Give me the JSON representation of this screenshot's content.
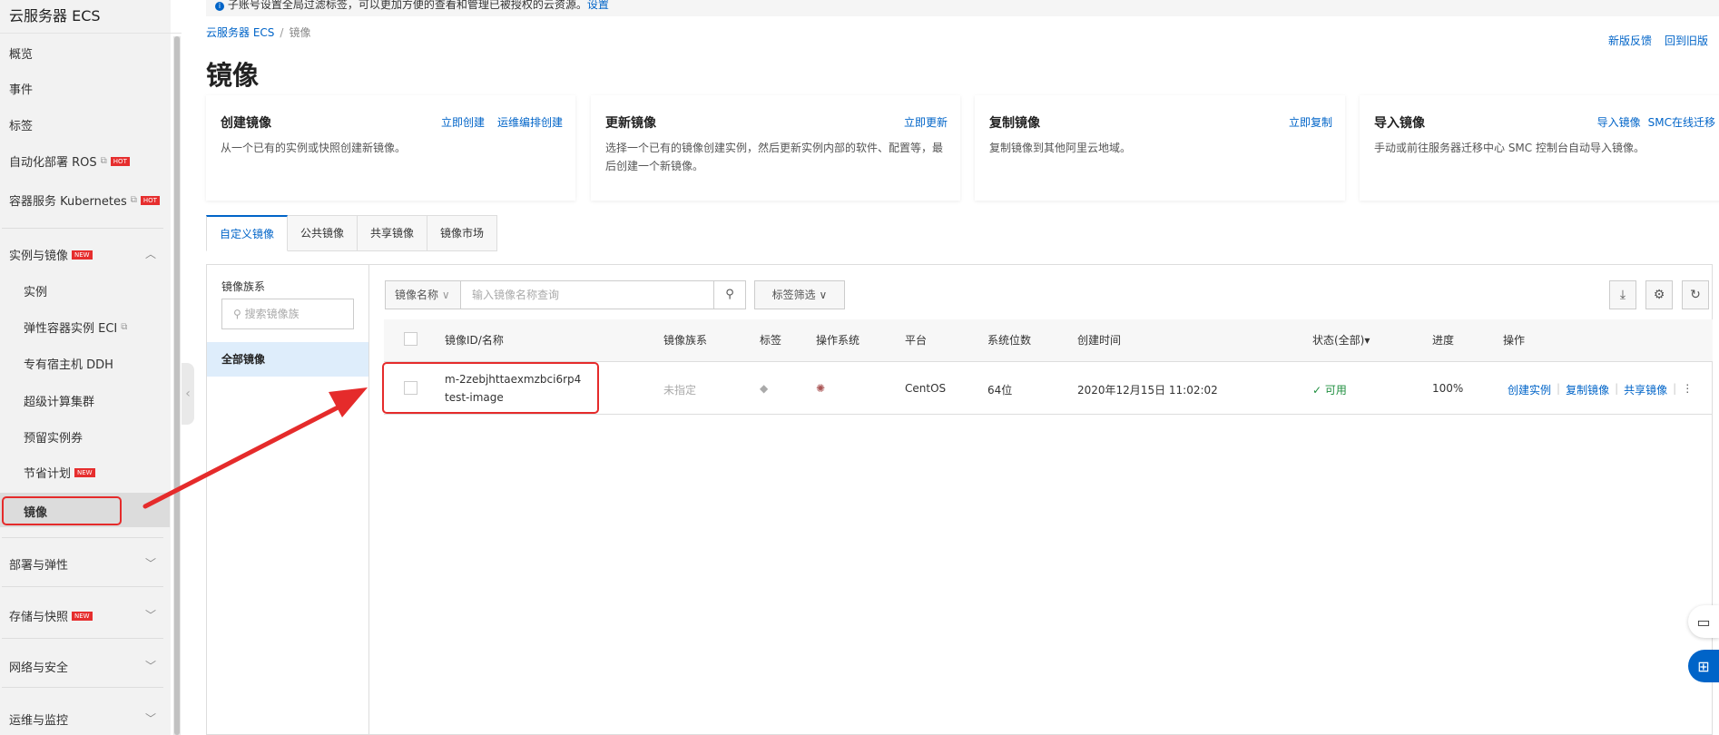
{
  "sidebar": {
    "title": "云服务器 ECS",
    "items": [
      {
        "label": "概览"
      },
      {
        "label": "事件"
      },
      {
        "label": "标签"
      },
      {
        "label": "自动化部署 ROS",
        "badge": "HOT"
      },
      {
        "label": "容器服务 Kubernetes",
        "badge": "HOT"
      }
    ],
    "group1": {
      "label": "实例与镜像",
      "badge": "NEW",
      "children": [
        {
          "label": "实例"
        },
        {
          "label": "弹性容器实例 ECI"
        },
        {
          "label": "专有宿主机 DDH"
        },
        {
          "label": "超级计算集群"
        },
        {
          "label": "预留实例券"
        },
        {
          "label": "节省计划",
          "badge": "NEW"
        },
        {
          "label": "镜像"
        }
      ]
    },
    "groups": [
      {
        "label": "部署与弹性"
      },
      {
        "label": "存储与快照",
        "badge": "NEW"
      },
      {
        "label": "网络与安全"
      },
      {
        "label": "运维与监控"
      }
    ]
  },
  "notice": {
    "text": "子账号设置全局过滤标签，可以更加方便的查看和管理已被授权的云资源。",
    "link": "设置"
  },
  "breadcrumb": {
    "root": "云服务器 ECS",
    "current": "镜像"
  },
  "toplinks": {
    "feedback": "新版反馈",
    "old": "回到旧版"
  },
  "page_title": "镜像",
  "cards": [
    {
      "title": "创建镜像",
      "actions": [
        "立即创建",
        "运维编排创建"
      ],
      "desc": "从一个已有的实例或快照创建新镜像。"
    },
    {
      "title": "更新镜像",
      "actions": [
        "立即更新"
      ],
      "desc": "选择一个已有的镜像创建实例，然后更新实例内部的软件、配置等，最后创建一个新镜像。"
    },
    {
      "title": "复制镜像",
      "actions": [
        "立即复制"
      ],
      "desc": "复制镜像到其他阿里云地域。"
    },
    {
      "title": "导入镜像",
      "actions": [
        "导入镜像",
        "SMC在线迁移"
      ],
      "desc": "手动或前往服务器迁移中心 SMC 控制台自动导入镜像。"
    }
  ],
  "tabs": [
    "自定义镜像",
    "公共镜像",
    "共享镜像",
    "镜像市场"
  ],
  "family": {
    "label": "镜像族系",
    "placeholder": "搜索镜像族",
    "all": "全部镜像"
  },
  "search": {
    "field": "镜像名称",
    "placeholder": "输入镜像名称查询",
    "tag_filter": "标签筛选"
  },
  "table": {
    "columns": [
      "镜像ID/名称",
      "镜像族系",
      "标签",
      "操作系统",
      "平台",
      "系统位数",
      "创建时间",
      "状态(全部)",
      "进度",
      "操作"
    ],
    "rows": [
      {
        "id": "m-2zebjhttaexmzbci6rp4",
        "name": "test-image",
        "family": "未指定",
        "platform": "CentOS",
        "bits": "64位",
        "created": "2020年12月15日 11:02:02",
        "status": "可用",
        "progress": "100%",
        "actions": [
          "创建实例",
          "复制镜像",
          "共享镜像"
        ]
      }
    ]
  },
  "colors": {
    "accent": "#0064c8",
    "annotation": "#e52b2b",
    "status_ok": "#1e8e3e"
  }
}
